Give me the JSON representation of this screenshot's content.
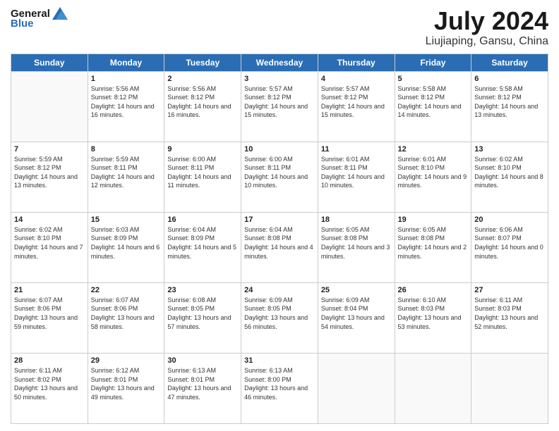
{
  "header": {
    "logo_line1": "General",
    "logo_line2": "Blue",
    "title": "July 2024",
    "subtitle": "Liujiaping, Gansu, China"
  },
  "weekdays": [
    "Sunday",
    "Monday",
    "Tuesday",
    "Wednesday",
    "Thursday",
    "Friday",
    "Saturday"
  ],
  "weeks": [
    [
      {
        "day": "",
        "sunrise": "",
        "sunset": "",
        "daylight": ""
      },
      {
        "day": "1",
        "sunrise": "Sunrise: 5:56 AM",
        "sunset": "Sunset: 8:12 PM",
        "daylight": "Daylight: 14 hours and 16 minutes."
      },
      {
        "day": "2",
        "sunrise": "Sunrise: 5:56 AM",
        "sunset": "Sunset: 8:12 PM",
        "daylight": "Daylight: 14 hours and 16 minutes."
      },
      {
        "day": "3",
        "sunrise": "Sunrise: 5:57 AM",
        "sunset": "Sunset: 8:12 PM",
        "daylight": "Daylight: 14 hours and 15 minutes."
      },
      {
        "day": "4",
        "sunrise": "Sunrise: 5:57 AM",
        "sunset": "Sunset: 8:12 PM",
        "daylight": "Daylight: 14 hours and 15 minutes."
      },
      {
        "day": "5",
        "sunrise": "Sunrise: 5:58 AM",
        "sunset": "Sunset: 8:12 PM",
        "daylight": "Daylight: 14 hours and 14 minutes."
      },
      {
        "day": "6",
        "sunrise": "Sunrise: 5:58 AM",
        "sunset": "Sunset: 8:12 PM",
        "daylight": "Daylight: 14 hours and 13 minutes."
      }
    ],
    [
      {
        "day": "7",
        "sunrise": "Sunrise: 5:59 AM",
        "sunset": "Sunset: 8:12 PM",
        "daylight": "Daylight: 14 hours and 13 minutes."
      },
      {
        "day": "8",
        "sunrise": "Sunrise: 5:59 AM",
        "sunset": "Sunset: 8:11 PM",
        "daylight": "Daylight: 14 hours and 12 minutes."
      },
      {
        "day": "9",
        "sunrise": "Sunrise: 6:00 AM",
        "sunset": "Sunset: 8:11 PM",
        "daylight": "Daylight: 14 hours and 11 minutes."
      },
      {
        "day": "10",
        "sunrise": "Sunrise: 6:00 AM",
        "sunset": "Sunset: 8:11 PM",
        "daylight": "Daylight: 14 hours and 10 minutes."
      },
      {
        "day": "11",
        "sunrise": "Sunrise: 6:01 AM",
        "sunset": "Sunset: 8:11 PM",
        "daylight": "Daylight: 14 hours and 10 minutes."
      },
      {
        "day": "12",
        "sunrise": "Sunrise: 6:01 AM",
        "sunset": "Sunset: 8:10 PM",
        "daylight": "Daylight: 14 hours and 9 minutes."
      },
      {
        "day": "13",
        "sunrise": "Sunrise: 6:02 AM",
        "sunset": "Sunset: 8:10 PM",
        "daylight": "Daylight: 14 hours and 8 minutes."
      }
    ],
    [
      {
        "day": "14",
        "sunrise": "Sunrise: 6:02 AM",
        "sunset": "Sunset: 8:10 PM",
        "daylight": "Daylight: 14 hours and 7 minutes."
      },
      {
        "day": "15",
        "sunrise": "Sunrise: 6:03 AM",
        "sunset": "Sunset: 8:09 PM",
        "daylight": "Daylight: 14 hours and 6 minutes."
      },
      {
        "day": "16",
        "sunrise": "Sunrise: 6:04 AM",
        "sunset": "Sunset: 8:09 PM",
        "daylight": "Daylight: 14 hours and 5 minutes."
      },
      {
        "day": "17",
        "sunrise": "Sunrise: 6:04 AM",
        "sunset": "Sunset: 8:08 PM",
        "daylight": "Daylight: 14 hours and 4 minutes."
      },
      {
        "day": "18",
        "sunrise": "Sunrise: 6:05 AM",
        "sunset": "Sunset: 8:08 PM",
        "daylight": "Daylight: 14 hours and 3 minutes."
      },
      {
        "day": "19",
        "sunrise": "Sunrise: 6:05 AM",
        "sunset": "Sunset: 8:08 PM",
        "daylight": "Daylight: 14 hours and 2 minutes."
      },
      {
        "day": "20",
        "sunrise": "Sunrise: 6:06 AM",
        "sunset": "Sunset: 8:07 PM",
        "daylight": "Daylight: 14 hours and 0 minutes."
      }
    ],
    [
      {
        "day": "21",
        "sunrise": "Sunrise: 6:07 AM",
        "sunset": "Sunset: 8:06 PM",
        "daylight": "Daylight: 13 hours and 59 minutes."
      },
      {
        "day": "22",
        "sunrise": "Sunrise: 6:07 AM",
        "sunset": "Sunset: 8:06 PM",
        "daylight": "Daylight: 13 hours and 58 minutes."
      },
      {
        "day": "23",
        "sunrise": "Sunrise: 6:08 AM",
        "sunset": "Sunset: 8:05 PM",
        "daylight": "Daylight: 13 hours and 57 minutes."
      },
      {
        "day": "24",
        "sunrise": "Sunrise: 6:09 AM",
        "sunset": "Sunset: 8:05 PM",
        "daylight": "Daylight: 13 hours and 56 minutes."
      },
      {
        "day": "25",
        "sunrise": "Sunrise: 6:09 AM",
        "sunset": "Sunset: 8:04 PM",
        "daylight": "Daylight: 13 hours and 54 minutes."
      },
      {
        "day": "26",
        "sunrise": "Sunrise: 6:10 AM",
        "sunset": "Sunset: 8:03 PM",
        "daylight": "Daylight: 13 hours and 53 minutes."
      },
      {
        "day": "27",
        "sunrise": "Sunrise: 6:11 AM",
        "sunset": "Sunset: 8:03 PM",
        "daylight": "Daylight: 13 hours and 52 minutes."
      }
    ],
    [
      {
        "day": "28",
        "sunrise": "Sunrise: 6:11 AM",
        "sunset": "Sunset: 8:02 PM",
        "daylight": "Daylight: 13 hours and 50 minutes."
      },
      {
        "day": "29",
        "sunrise": "Sunrise: 6:12 AM",
        "sunset": "Sunset: 8:01 PM",
        "daylight": "Daylight: 13 hours and 49 minutes."
      },
      {
        "day": "30",
        "sunrise": "Sunrise: 6:13 AM",
        "sunset": "Sunset: 8:01 PM",
        "daylight": "Daylight: 13 hours and 47 minutes."
      },
      {
        "day": "31",
        "sunrise": "Sunrise: 6:13 AM",
        "sunset": "Sunset: 8:00 PM",
        "daylight": "Daylight: 13 hours and 46 minutes."
      },
      {
        "day": "",
        "sunrise": "",
        "sunset": "",
        "daylight": ""
      },
      {
        "day": "",
        "sunrise": "",
        "sunset": "",
        "daylight": ""
      },
      {
        "day": "",
        "sunrise": "",
        "sunset": "",
        "daylight": ""
      }
    ]
  ]
}
